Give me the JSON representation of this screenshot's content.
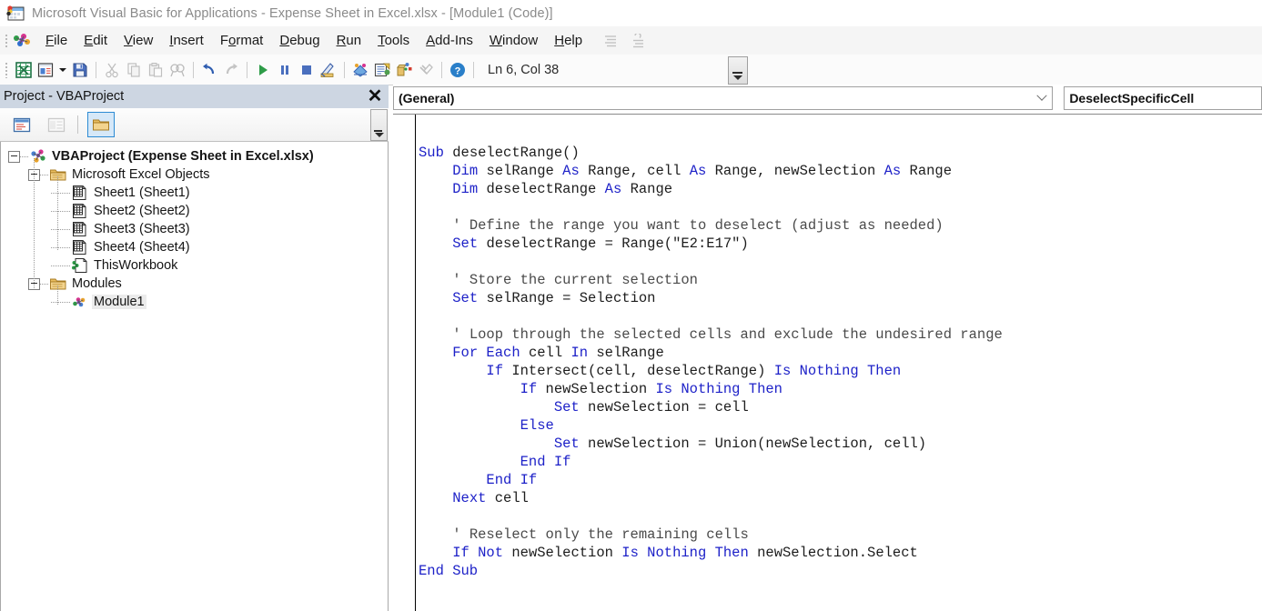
{
  "window": {
    "title": "Microsoft Visual Basic for Applications - Expense Sheet in Excel.xlsx - [Module1 (Code)]",
    "app_icon": "vba-window-icon"
  },
  "menubar": {
    "items": [
      {
        "label": "File",
        "accel": "F"
      },
      {
        "label": "Edit",
        "accel": "E"
      },
      {
        "label": "View",
        "accel": "V"
      },
      {
        "label": "Insert",
        "accel": "I"
      },
      {
        "label": "Format",
        "accel": "o"
      },
      {
        "label": "Debug",
        "accel": "D"
      },
      {
        "label": "Run",
        "accel": "R"
      },
      {
        "label": "Tools",
        "accel": "T"
      },
      {
        "label": "Add-Ins",
        "accel": "A"
      },
      {
        "label": "Window",
        "accel": "W"
      },
      {
        "label": "Help",
        "accel": "H"
      }
    ],
    "app_icon": "vba-palette-icon",
    "extra_icons": [
      "align-lines-icon",
      "indent-lines-icon"
    ]
  },
  "toolbar": {
    "buttons": [
      {
        "name": "view-excel-icon",
        "title": "View Microsoft Excel"
      },
      {
        "name": "insert-userform-icon",
        "title": "Insert UserForm"
      },
      {
        "name": "insert-dropdown-caret",
        "title": "Insert menu"
      },
      {
        "name": "save-icon",
        "title": "Save Expense Sheet in Excel.xlsx"
      },
      {
        "name": "cut-icon",
        "title": "Cut"
      },
      {
        "name": "copy-icon",
        "title": "Copy"
      },
      {
        "name": "paste-icon",
        "title": "Paste"
      },
      {
        "name": "find-icon",
        "title": "Find"
      },
      {
        "name": "undo-icon",
        "title": "Undo"
      },
      {
        "name": "redo-icon",
        "title": "Redo"
      },
      {
        "name": "run-icon",
        "title": "Run Sub/UserForm"
      },
      {
        "name": "pause-icon",
        "title": "Break"
      },
      {
        "name": "stop-icon",
        "title": "Reset"
      },
      {
        "name": "design-mode-icon",
        "title": "Design Mode"
      },
      {
        "name": "project-explorer-icon",
        "title": "Project Explorer"
      },
      {
        "name": "properties-window-icon",
        "title": "Properties Window"
      },
      {
        "name": "object-browser-icon",
        "title": "Object Browser"
      },
      {
        "name": "toolbox-icon",
        "title": "Toolbox"
      },
      {
        "name": "help-icon",
        "title": "Help"
      }
    ],
    "status_text": "Ln 6, Col 38"
  },
  "project_explorer": {
    "title": "Project - VBAProject",
    "close_label": "✕",
    "toolbar_buttons": [
      {
        "name": "view-code-icon",
        "selected": false
      },
      {
        "name": "view-object-icon",
        "selected": false
      },
      {
        "name": "toggle-folders-icon",
        "selected": true
      }
    ],
    "tree": [
      {
        "label": "VBAProject (Expense Sheet in Excel.xlsx)",
        "icon": "vba-project-icon",
        "level": 0,
        "bold": true,
        "expander": true,
        "selected": false
      },
      {
        "label": "Microsoft Excel Objects",
        "icon": "folder-icon",
        "level": 1,
        "bold": false,
        "expander": true,
        "selected": false
      },
      {
        "label": "Sheet1 (Sheet1)",
        "icon": "worksheet-icon",
        "level": 2,
        "bold": false,
        "expander": false,
        "selected": false
      },
      {
        "label": "Sheet2 (Sheet2)",
        "icon": "worksheet-icon",
        "level": 2,
        "bold": false,
        "expander": false,
        "selected": false
      },
      {
        "label": "Sheet3 (Sheet3)",
        "icon": "worksheet-icon",
        "level": 2,
        "bold": false,
        "expander": false,
        "selected": false
      },
      {
        "label": "Sheet4 (Sheet4)",
        "icon": "worksheet-icon",
        "level": 2,
        "bold": false,
        "expander": false,
        "selected": false
      },
      {
        "label": "ThisWorkbook",
        "icon": "workbook-icon",
        "level": 2,
        "bold": false,
        "expander": false,
        "selected": false
      },
      {
        "label": "Modules",
        "icon": "folder-icon",
        "level": 1,
        "bold": false,
        "expander": true,
        "selected": false
      },
      {
        "label": "Module1",
        "icon": "module-icon",
        "level": 2,
        "bold": false,
        "expander": false,
        "selected": true
      }
    ]
  },
  "code_pane": {
    "object_combo": "(General)",
    "procedure_combo": "DeselectSpecificCell",
    "lines": [
      [
        {
          "t": "Sub ",
          "c": "kw"
        },
        {
          "t": "deselectRange()",
          "c": ""
        }
      ],
      [
        {
          "t": "    ",
          "c": ""
        },
        {
          "t": "Dim ",
          "c": "kw"
        },
        {
          "t": "selRange ",
          "c": ""
        },
        {
          "t": "As ",
          "c": "kw"
        },
        {
          "t": "Range, cell ",
          "c": ""
        },
        {
          "t": "As ",
          "c": "kw"
        },
        {
          "t": "Range, newSelection ",
          "c": ""
        },
        {
          "t": "As ",
          "c": "kw"
        },
        {
          "t": "Range",
          "c": ""
        }
      ],
      [
        {
          "t": "    ",
          "c": ""
        },
        {
          "t": "Dim ",
          "c": "kw"
        },
        {
          "t": "deselectRange ",
          "c": ""
        },
        {
          "t": "As ",
          "c": "kw"
        },
        {
          "t": "Range",
          "c": ""
        }
      ],
      [],
      [
        {
          "t": "    ",
          "c": ""
        },
        {
          "t": "' Define the range you want to deselect (adjust as needed)",
          "c": "cm"
        }
      ],
      [
        {
          "t": "    ",
          "c": ""
        },
        {
          "t": "Set ",
          "c": "kw"
        },
        {
          "t": "deselectRange = Range(\"E2:E17\")",
          "c": ""
        }
      ],
      [],
      [
        {
          "t": "    ",
          "c": ""
        },
        {
          "t": "' Store the current selection",
          "c": "cm"
        }
      ],
      [
        {
          "t": "    ",
          "c": ""
        },
        {
          "t": "Set ",
          "c": "kw"
        },
        {
          "t": "selRange = Selection",
          "c": ""
        }
      ],
      [],
      [
        {
          "t": "    ",
          "c": ""
        },
        {
          "t": "' Loop through the selected cells and exclude the undesired range",
          "c": "cm"
        }
      ],
      [
        {
          "t": "    ",
          "c": ""
        },
        {
          "t": "For Each ",
          "c": "kw"
        },
        {
          "t": "cell ",
          "c": ""
        },
        {
          "t": "In ",
          "c": "kw"
        },
        {
          "t": "selRange",
          "c": ""
        }
      ],
      [
        {
          "t": "        ",
          "c": ""
        },
        {
          "t": "If ",
          "c": "kw"
        },
        {
          "t": "Intersect(cell, deselectRange) ",
          "c": ""
        },
        {
          "t": "Is Nothing Then",
          "c": "kw"
        }
      ],
      [
        {
          "t": "            ",
          "c": ""
        },
        {
          "t": "If ",
          "c": "kw"
        },
        {
          "t": "newSelection ",
          "c": ""
        },
        {
          "t": "Is Nothing Then",
          "c": "kw"
        }
      ],
      [
        {
          "t": "                ",
          "c": ""
        },
        {
          "t": "Set ",
          "c": "kw"
        },
        {
          "t": "newSelection = cell",
          "c": ""
        }
      ],
      [
        {
          "t": "            ",
          "c": ""
        },
        {
          "t": "Else",
          "c": "kw"
        }
      ],
      [
        {
          "t": "                ",
          "c": ""
        },
        {
          "t": "Set ",
          "c": "kw"
        },
        {
          "t": "newSelection = Union(newSelection, cell)",
          "c": ""
        }
      ],
      [
        {
          "t": "            ",
          "c": ""
        },
        {
          "t": "End If",
          "c": "kw"
        }
      ],
      [
        {
          "t": "        ",
          "c": ""
        },
        {
          "t": "End If",
          "c": "kw"
        }
      ],
      [
        {
          "t": "    ",
          "c": ""
        },
        {
          "t": "Next ",
          "c": "kw"
        },
        {
          "t": "cell",
          "c": ""
        }
      ],
      [],
      [
        {
          "t": "    ",
          "c": ""
        },
        {
          "t": "' Reselect only the remaining cells",
          "c": "cm"
        }
      ],
      [
        {
          "t": "    ",
          "c": ""
        },
        {
          "t": "If Not ",
          "c": "kw"
        },
        {
          "t": "newSelection ",
          "c": ""
        },
        {
          "t": "Is Nothing Then ",
          "c": "kw"
        },
        {
          "t": "newSelection.Select",
          "c": ""
        }
      ],
      [
        {
          "t": "End Sub",
          "c": "kw"
        }
      ]
    ]
  },
  "colors": {
    "keyword": "#1e22c8",
    "comment": "#4a4a4a",
    "identifier": "#1d1d1d",
    "panel_title_bg": "#cdd6e2",
    "selection_bg": "#ebebeb",
    "accent_blue": "#2d8bd4"
  }
}
